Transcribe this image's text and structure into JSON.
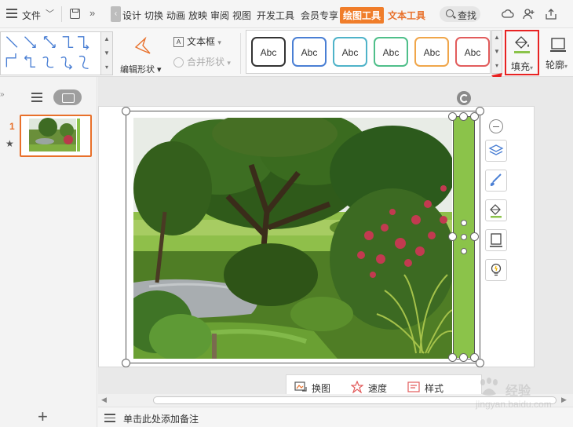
{
  "menubar": {
    "file_label": "文件",
    "tabs": [
      "设计",
      "切换",
      "动画",
      "放映",
      "审阅",
      "视图",
      "开发工具",
      "会员专享",
      "绘图工具",
      "文本工具"
    ],
    "active_tab": "绘图工具",
    "search_label": "查找"
  },
  "ribbon": {
    "edit_shape_label": "编辑形状",
    "textbox_label": "文本框",
    "merge_shape_label": "合并形状",
    "style_samples": [
      "Abc",
      "Abc",
      "Abc",
      "Abc",
      "Abc",
      "Abc"
    ],
    "style_colors": [
      "#333333",
      "#4a7fd4",
      "#4fb3c9",
      "#4fbf8a",
      "#f0a64a",
      "#e25c5c"
    ],
    "fill_label": "填充",
    "outline_label": "轮廓"
  },
  "slides_panel": {
    "slide_number": "1"
  },
  "picture_toolbar": {
    "replace_label": "换图",
    "speed_label": "速度",
    "style_label": "样式"
  },
  "notes": {
    "placeholder": "单击此处添加备注"
  },
  "colors": {
    "accent": "#e8702a",
    "active_tab_bg": "#f07d2a",
    "highlight_box": "#e82222",
    "fill_green": "#8bc34a"
  },
  "watermark": {
    "main": "经验",
    "sub": "jingyan.baidu.com"
  }
}
